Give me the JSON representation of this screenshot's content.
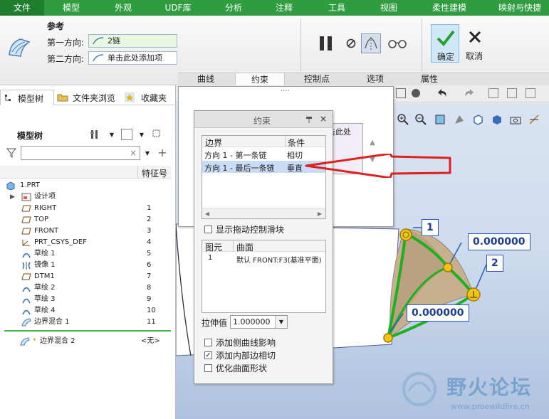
{
  "menubar": {
    "items": [
      "文件",
      "模型",
      "外观",
      "UDF库",
      "分析",
      "注释",
      "工具",
      "视图",
      "柔性建模",
      "映射与快捷"
    ]
  },
  "ribbon": {
    "group_title": "参考",
    "dir1_label": "第一方向:",
    "dir1_value": "2链",
    "dir2_label": "第二方向:",
    "dir2_value": "单击此处添加项",
    "ok_label": "确定",
    "cancel_label": "取消",
    "tabs": [
      "曲线",
      "约束",
      "控制点",
      "选项",
      "属性"
    ]
  },
  "left_panel": {
    "tabs": [
      "模型树",
      "文件夹浏览",
      "收藏夹"
    ],
    "tree_title": "模型树",
    "col_header": "特征号",
    "rows": [
      {
        "label": "1.PRT",
        "num": ""
      },
      {
        "label": "设计项",
        "num": ""
      },
      {
        "label": "RIGHT",
        "num": "1"
      },
      {
        "label": "TOP",
        "num": "2"
      },
      {
        "label": "FRONT",
        "num": "3"
      },
      {
        "label": "PRT_CSYS_DEF",
        "num": "4"
      },
      {
        "label": "草绘 1",
        "num": "5"
      },
      {
        "label": "镜像 1",
        "num": "6"
      },
      {
        "label": "DTM1",
        "num": "7"
      },
      {
        "label": "草绘 2",
        "num": "8"
      },
      {
        "label": "草绘 3",
        "num": "9"
      },
      {
        "label": "草绘 4",
        "num": "10"
      },
      {
        "label": "边界混合 1",
        "num": "11"
      }
    ],
    "insert_row": {
      "label": "边界混合 2",
      "num": "<无>"
    }
  },
  "back_panel": {
    "partial_text": "击此处"
  },
  "constraint_dialog": {
    "title": "约束",
    "col_boundary": "边界",
    "col_condition": "条件",
    "rows": [
      {
        "boundary": "方向 1 - 第一条链",
        "condition": "相切"
      },
      {
        "boundary": "方向 1 - 最后一条链",
        "condition": "垂直"
      }
    ],
    "show_handle_label": "显示拖动控制滑块",
    "col_element": "图元",
    "col_surface": "曲面",
    "surface_row": {
      "element": "1",
      "surface": "默认 FRONT:F3(基准平面)"
    },
    "stretch_label": "拉伸值",
    "stretch_value": "1.000000",
    "opt_side_curve": "添加侧曲线影响",
    "opt_inner_tangent": "添加内部边相切",
    "opt_optimize": "优化曲面形状",
    "opt_inner_tangent_checked": true
  },
  "viewport": {
    "callout_1": "1",
    "callout_2": "2",
    "value_top": "0.000000",
    "value_bottom": "0.000000"
  },
  "watermark": {
    "title": "野火论坛",
    "url": "www.proewildfire.cn"
  },
  "colors": {
    "menubar": "#2f9d3f",
    "curve_green": "#1fb01f",
    "arrow_red": "#e02020",
    "selection_blue": "#c9dcf5"
  }
}
